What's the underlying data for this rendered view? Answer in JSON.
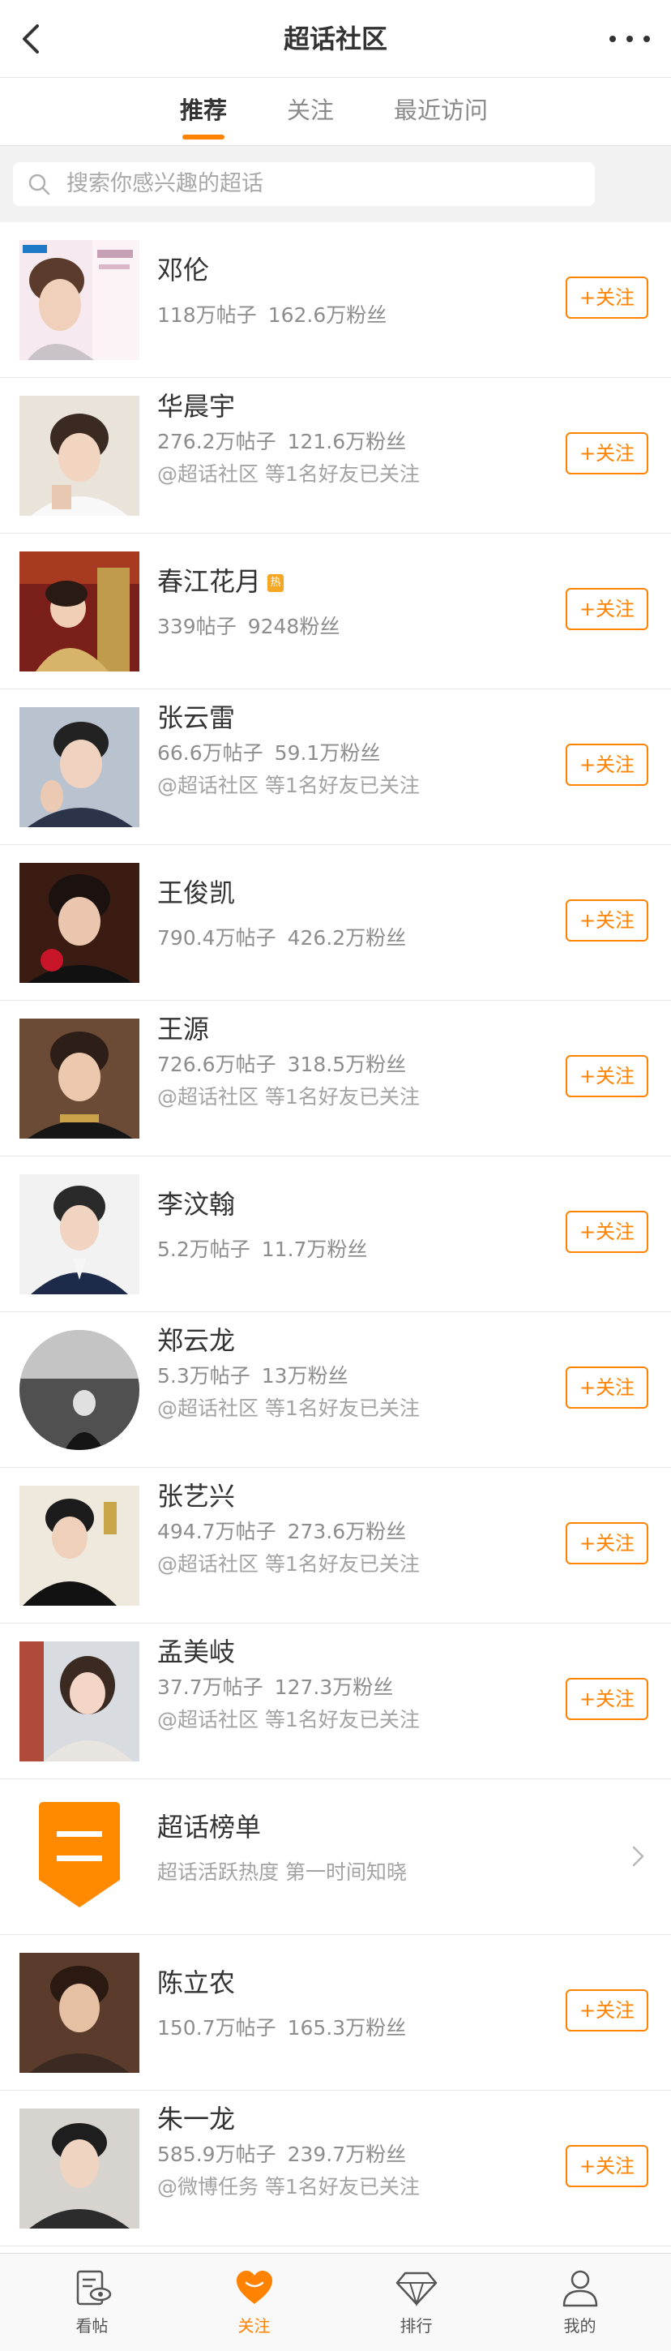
{
  "header": {
    "title": "超话社区",
    "back_icon": "chevron-left-icon",
    "more_icon": "more-dots-icon"
  },
  "tabs": [
    {
      "label": "推荐",
      "active": true
    },
    {
      "label": "关注",
      "active": false
    },
    {
      "label": "最近访问",
      "active": false
    }
  ],
  "search": {
    "placeholder": "搜索你感兴趣的超话"
  },
  "colors": {
    "accent": "#ff8200",
    "text": "#333333",
    "secondary": "#8d8d8d"
  },
  "follow_label": "+关注",
  "items": [
    {
      "name": "邓伦",
      "posts": "118万帖子",
      "fans": "162.6万粉丝",
      "friends": ""
    },
    {
      "name": "华晨宇",
      "posts": "276.2万帖子",
      "fans": "121.6万粉丝",
      "friends": "@超话社区 等1名好友已关注"
    },
    {
      "name": "春江花月",
      "badge": "热",
      "posts": "339帖子",
      "fans": "9248粉丝",
      "friends": ""
    },
    {
      "name": "张云雷",
      "posts": "66.6万帖子",
      "fans": "59.1万粉丝",
      "friends": "@超话社区 等1名好友已关注"
    },
    {
      "name": "王俊凯",
      "posts": "790.4万帖子",
      "fans": "426.2万粉丝",
      "friends": ""
    },
    {
      "name": "王源",
      "posts": "726.6万帖子",
      "fans": "318.5万粉丝",
      "friends": "@超话社区 等1名好友已关注"
    },
    {
      "name": "李汶翰",
      "posts": "5.2万帖子",
      "fans": "11.7万粉丝",
      "friends": ""
    },
    {
      "name": "郑云龙",
      "posts": "5.3万帖子",
      "fans": "13万粉丝",
      "friends": "@超话社区 等1名好友已关注"
    },
    {
      "name": "张艺兴",
      "posts": "494.7万帖子",
      "fans": "273.6万粉丝",
      "friends": "@超话社区 等1名好友已关注"
    },
    {
      "name": "孟美岐",
      "posts": "37.7万帖子",
      "fans": "127.3万粉丝",
      "friends": "@超话社区 等1名好友已关注"
    }
  ],
  "ranking": {
    "title": "超话榜单",
    "subtitle": "超话活跃热度 第一时间知晓"
  },
  "items2": [
    {
      "name": "陈立农",
      "posts": "150.7万帖子",
      "fans": "165.3万粉丝",
      "friends": ""
    },
    {
      "name": "朱一龙",
      "posts": "585.9万帖子",
      "fans": "239.7万粉丝",
      "friends": "@微博任务 等1名好友已关注"
    }
  ],
  "tabbar": [
    {
      "label": "看帖",
      "icon": "view-posts-icon",
      "active": false
    },
    {
      "label": "关注",
      "icon": "heart-icon",
      "active": true
    },
    {
      "label": "排行",
      "icon": "diamond-icon",
      "active": false
    },
    {
      "label": "我的",
      "icon": "person-icon",
      "active": false
    }
  ]
}
